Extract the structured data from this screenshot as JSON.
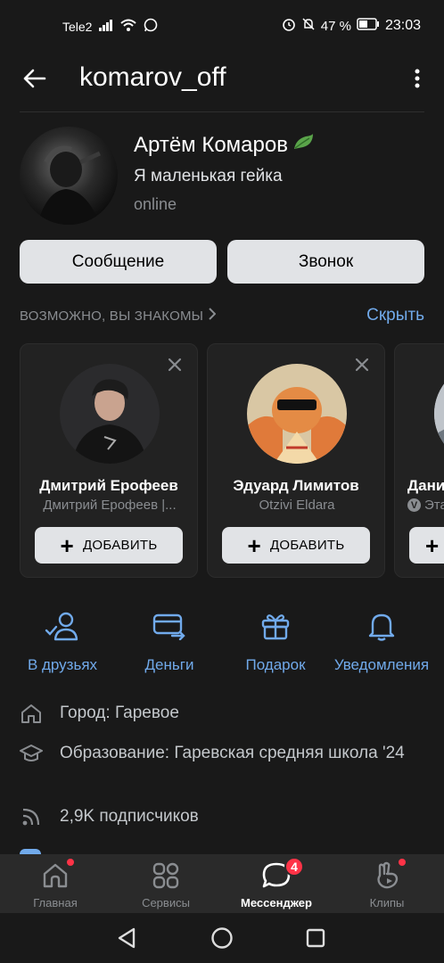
{
  "status_bar": {
    "carrier": "Tele2",
    "battery": "47 %",
    "time": "23:03"
  },
  "header": {
    "title": "komarov_off"
  },
  "profile": {
    "name": "Артём Комаров",
    "status": "Я маленькая гейка",
    "online": "online",
    "message_button": "Сообщение",
    "call_button": "Звонок"
  },
  "suggestions": {
    "title": "ВОЗМОЖНО, ВЫ ЗНАКОМЫ",
    "hide": "Скрыть",
    "add_label": "ДОБАВИТЬ",
    "cards": [
      {
        "name": "Дмитрий Ерофеев",
        "subtitle": "Дмитрий Ерофеев |..."
      },
      {
        "name": "Эдуард Лимитов",
        "subtitle": "Otzivi Eldara"
      },
      {
        "name": "Дани",
        "subtitle": "Эта"
      }
    ]
  },
  "actions": [
    {
      "label": "В друзьях",
      "icon": "friends-check-icon"
    },
    {
      "label": "Деньги",
      "icon": "money-transfer-icon"
    },
    {
      "label": "Подарок",
      "icon": "gift-icon"
    },
    {
      "label": "Уведомления",
      "icon": "bell-icon"
    }
  ],
  "info": {
    "city": "Город: Гаревое",
    "education": "Образование: Гаревская средняя школа '24",
    "followers": "2,9K подписчиков"
  },
  "bottom_nav": [
    {
      "label": "Главная",
      "icon": "home-icon",
      "dot": true
    },
    {
      "label": "Сервисы",
      "icon": "services-icon"
    },
    {
      "label": "Мессенджер",
      "icon": "messenger-icon",
      "badge": "4",
      "active": true
    },
    {
      "label": "Клипы",
      "icon": "clips-icon",
      "dot": true
    }
  ],
  "colors": {
    "background": "#191919",
    "accent": "#71aaeb",
    "badge": "#ff3347",
    "button": "#e1e3e6"
  }
}
